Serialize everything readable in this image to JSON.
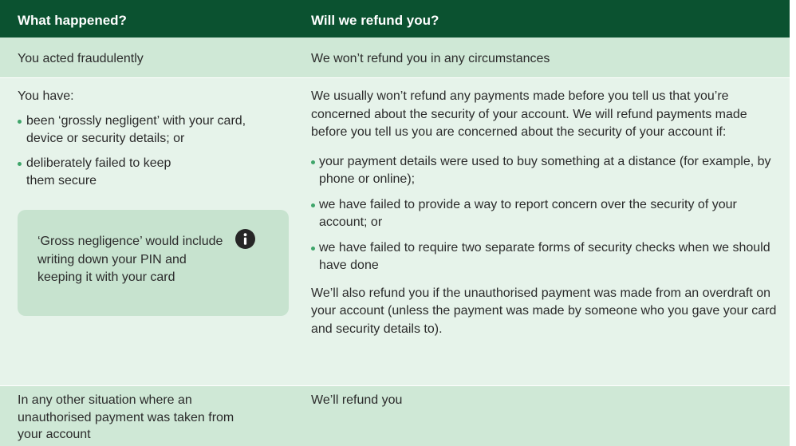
{
  "header": {
    "col1": "What happened?",
    "col2": "Will we refund you?"
  },
  "rows": [
    {
      "happened": "You acted fraudulently",
      "refund": "We won’t refund you in any circumstances"
    },
    {
      "happened_intro": "You have:",
      "happened_bullets": [
        "been ‘grossly negligent’ with your card, device or security details; or",
        "deliberately failed to keep them secure"
      ],
      "note": {
        "text": "‘Gross negligence’ would include writing down your PIN and keeping it with your card",
        "icon": "info-icon"
      },
      "refund_intro": "We usually won’t refund any payments made before you tell us that you’re concerned about the security of your account. We will refund payments made before you tell us you are concerned about the security of your account if:",
      "refund_bullets": [
        "your payment details were used to buy something at a distance (for example, by phone or online);",
        "we have failed to provide a way to report concern over the security of your account; or",
        "we have failed to require two separate forms of security checks when we should have done"
      ],
      "refund_outro": "We’ll also refund you if the unauthorised payment was made from an overdraft on your account (unless the payment was made by someone who you gave your card and security details to)."
    },
    {
      "happened": "In any other situation where an unauthorised payment was taken from your account",
      "refund": "We’ll refund you"
    }
  ],
  "colors": {
    "header_bg": "#0b5230",
    "row_dark": "#cfe8d6",
    "row_light": "#e6f3ea",
    "note_bg": "#c7e3cf",
    "bullet": "#3fa56a"
  }
}
